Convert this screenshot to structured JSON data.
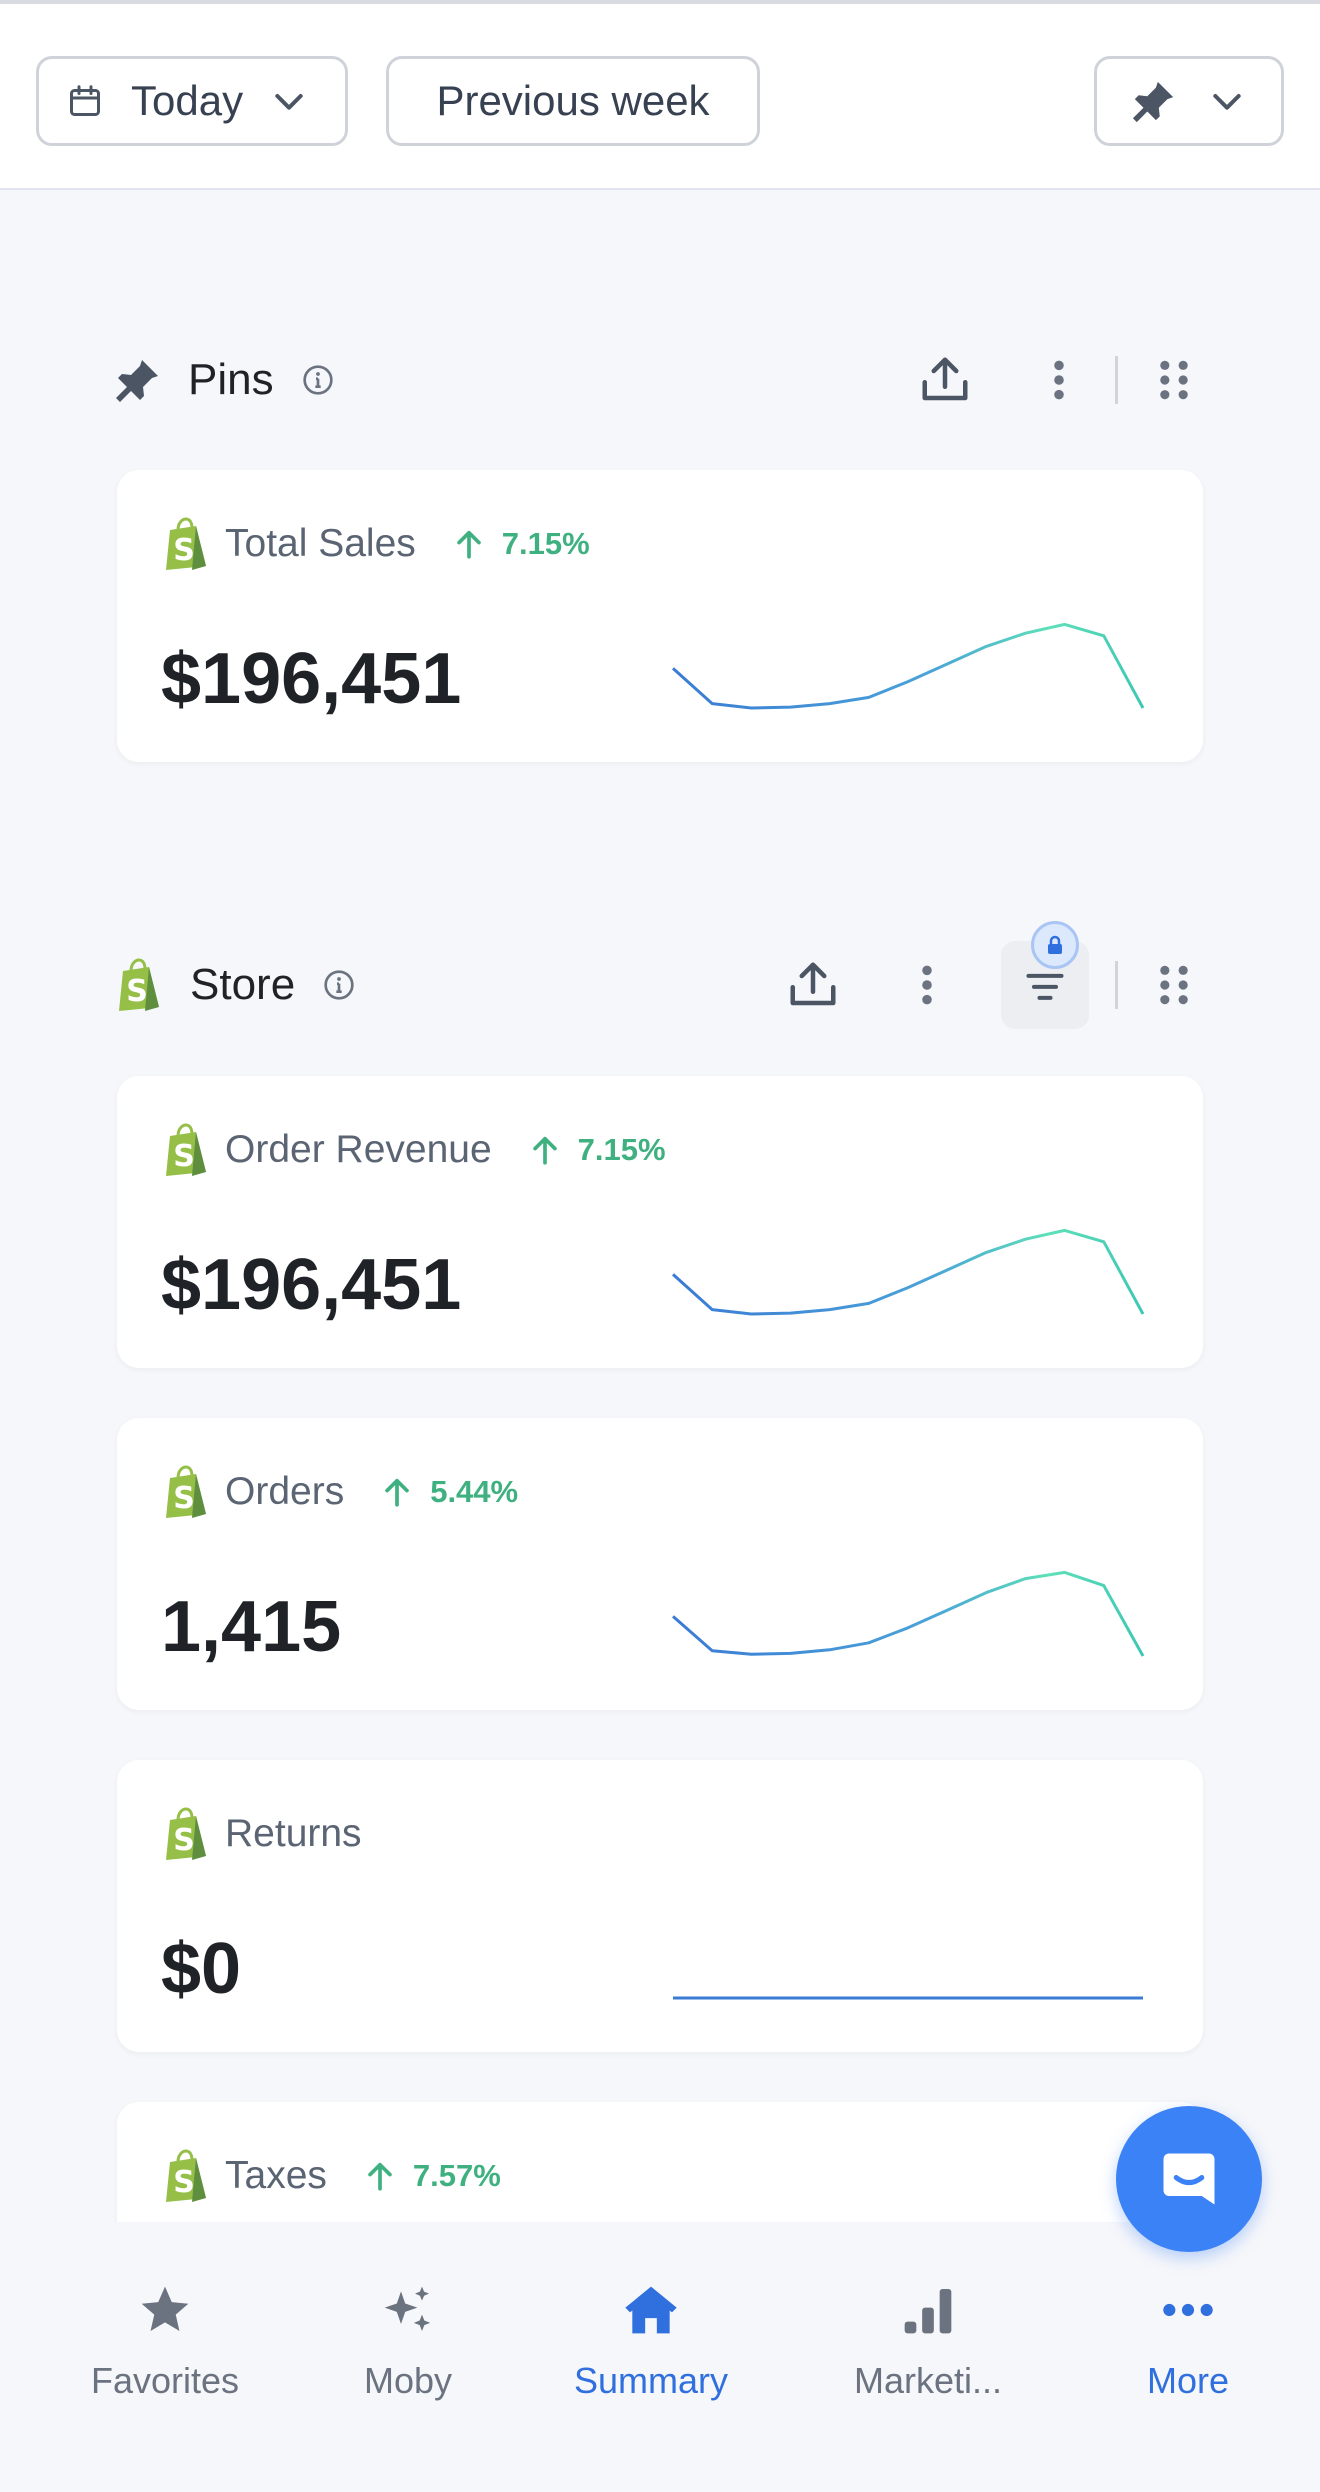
{
  "toolbar": {
    "date_label": "Today",
    "compare_label": "Previous week"
  },
  "sections": [
    {
      "title": "Pins",
      "cards": [
        {
          "title": "Total Sales",
          "change": "7.15%",
          "value": "$196,451",
          "trend": [
            0.45,
            0.05,
            0.0,
            0.01,
            0.05,
            0.12,
            0.3,
            0.5,
            0.7,
            0.85,
            0.95,
            0.82,
            0.0
          ]
        }
      ]
    },
    {
      "title": "Store",
      "cards": [
        {
          "title": "Order Revenue",
          "change": "7.15%",
          "value": "$196,451",
          "trend": [
            0.45,
            0.05,
            0.0,
            0.01,
            0.05,
            0.12,
            0.3,
            0.5,
            0.7,
            0.85,
            0.95,
            0.82,
            0.0
          ]
        },
        {
          "title": "Orders",
          "change": "5.44%",
          "value": "1,415",
          "trend": [
            0.45,
            0.06,
            0.02,
            0.03,
            0.07,
            0.15,
            0.32,
            0.52,
            0.72,
            0.88,
            0.95,
            0.8,
            0.0
          ]
        },
        {
          "title": "Returns",
          "change": "",
          "value": "$0",
          "trend": [
            0,
            0,
            0,
            0,
            0,
            0,
            0,
            0,
            0,
            0,
            0,
            0,
            0
          ]
        },
        {
          "title": "Taxes",
          "change": "7.57%",
          "value": "",
          "trend": []
        }
      ]
    }
  ],
  "bottom_nav": [
    {
      "label": "Favorites",
      "icon": "star-icon"
    },
    {
      "label": "Moby",
      "icon": "sparkles-icon"
    },
    {
      "label": "Summary",
      "icon": "home-icon"
    },
    {
      "label": "Marketi...",
      "icon": "bar-chart-icon"
    },
    {
      "label": "More",
      "icon": "dots-icon"
    }
  ],
  "colors": {
    "accent": "#2f6fde",
    "positive": "#3fb07f",
    "shopify_green": "#95bf47",
    "spark_start": "#3a7bd5",
    "spark_end": "#5ee0b8",
    "fab": "#3b82f6"
  }
}
